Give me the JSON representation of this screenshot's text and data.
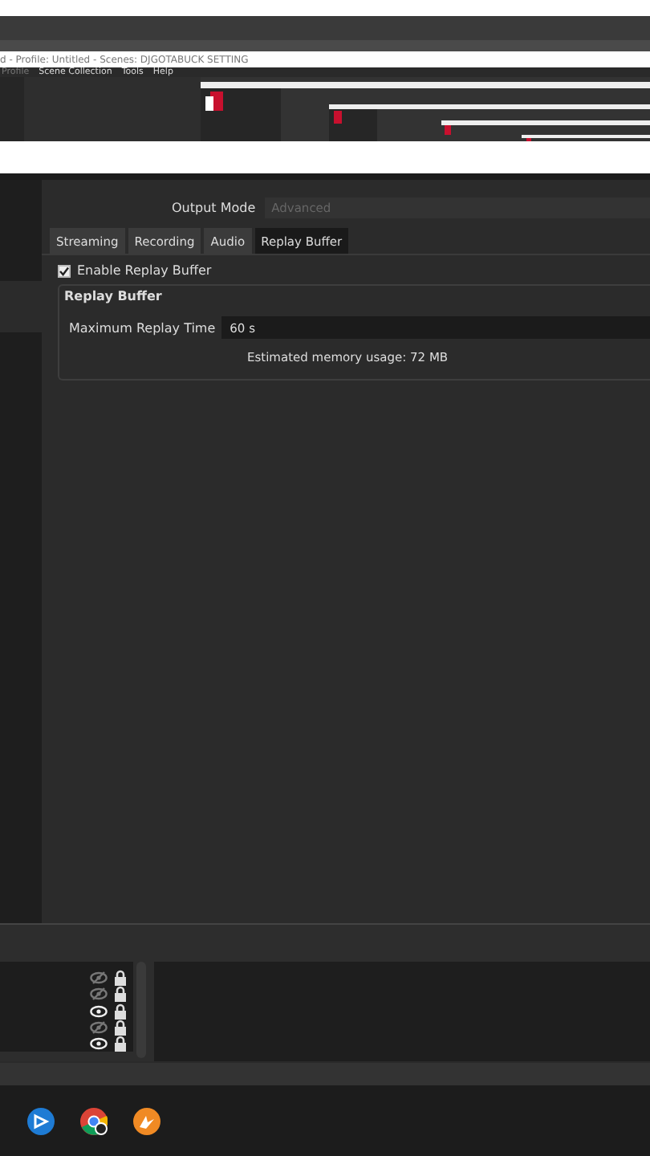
{
  "obs_window": {
    "title": "d - Profile: Untitled - Scenes: DJGOTABUCK SETTING",
    "menu": [
      {
        "label": "Profile",
        "disabled": true
      },
      {
        "label": "Scene Collection",
        "disabled": false
      },
      {
        "label": "Tools",
        "disabled": false
      },
      {
        "label": "Help",
        "disabled": false
      }
    ]
  },
  "settings": {
    "output_mode": {
      "label": "Output Mode",
      "value": "Advanced",
      "disabled": true
    },
    "tabs": [
      {
        "label": "Streaming",
        "selected": false
      },
      {
        "label": "Recording",
        "selected": false
      },
      {
        "label": "Audio",
        "selected": false
      },
      {
        "label": "Replay Buffer",
        "selected": true
      }
    ],
    "enable_replay_buffer": {
      "label": "Enable Replay Buffer",
      "checked": true
    },
    "group": {
      "title": "Replay Buffer",
      "max_time_label": "Maximum Replay Time",
      "max_time_value": "60 s",
      "memory_note": "Estimated memory usage: 72 MB"
    }
  },
  "sources": [
    {
      "visible": false,
      "locked": true
    },
    {
      "visible": false,
      "locked": true
    },
    {
      "visible": true,
      "locked": true
    },
    {
      "visible": false,
      "locked": true
    },
    {
      "visible": true,
      "locked": true
    }
  ],
  "taskbar": [
    {
      "kind": "share"
    },
    {
      "kind": "chrome"
    },
    {
      "kind": "orange"
    }
  ]
}
